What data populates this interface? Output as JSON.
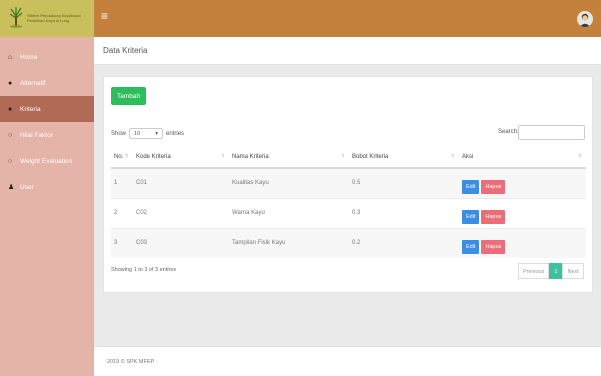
{
  "brand": {
    "line1": "Sistem Pendukung Keputusan",
    "line2": "Pemilihan Kayu di Lung"
  },
  "sidebar": {
    "items": [
      {
        "label": "Home",
        "icon": "home-icon"
      },
      {
        "label": "Alternatif",
        "icon": "dot-icon"
      },
      {
        "label": "Kriteria",
        "icon": "dot-icon",
        "active": true
      },
      {
        "label": "Nilai Faktor",
        "icon": "ring-icon"
      },
      {
        "label": "Weight Evaluation",
        "icon": "ring-icon"
      },
      {
        "label": "User",
        "icon": "user-icon"
      }
    ]
  },
  "header": {
    "title": "Data Kriteria"
  },
  "toolbar": {
    "add_label": "Tambah"
  },
  "datatable": {
    "show_label": "Show",
    "entries_label": "entries",
    "length_value": "10",
    "search_label": "Search:",
    "search_value": "",
    "columns": [
      "No.",
      "Kode Kriteria",
      "Nama Kriteria",
      "Bobot Kriteria",
      "Aksi"
    ],
    "rows": [
      {
        "no": "1",
        "kode": "C01",
        "nama": "Kualitas Kayu",
        "bobot": "0.5"
      },
      {
        "no": "2",
        "kode": "C02",
        "nama": "Warna Kayu",
        "bobot": "0.3"
      },
      {
        "no": "3",
        "kode": "C03",
        "nama": "Tampilan Fisik Kayu",
        "bobot": "0.2"
      }
    ],
    "edit_label": "Edit",
    "delete_label": "Hapus",
    "info": "Showing 1 to 3 of 3 entries",
    "pagination": {
      "previous": "Previous",
      "current": "1",
      "next": "Next"
    }
  },
  "footer": {
    "text": "2019 © SPK MFEP"
  },
  "colors": {
    "topbar": "#c4813e",
    "brand_bg": "#c9bf5c",
    "sidebar": "#e4b4a9",
    "sidebar_active": "#b06a55",
    "add_button": "#2dbd5b",
    "edit_button": "#3b8ee3",
    "delete_button": "#ec6c78",
    "pager_active": "#3fc1a0"
  }
}
